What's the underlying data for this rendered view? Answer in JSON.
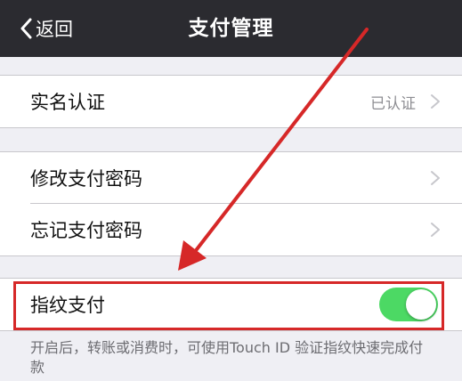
{
  "navbar": {
    "back_label": "返回",
    "title": "支付管理"
  },
  "sections": {
    "realname": {
      "label": "实名认证",
      "value": "已认证"
    },
    "change_password": {
      "label": "修改支付密码"
    },
    "forgot_password": {
      "label": "忘记支付密码"
    },
    "fingerprint": {
      "label": "指纹支付",
      "enabled": true
    }
  },
  "footnote": "开启后，转账或消费时，可使用Touch ID 验证指纹快速完成付款",
  "colors": {
    "navbar_bg": "#2b2b30",
    "toggle_on": "#4cd964",
    "annotation_red": "#d62828",
    "page_bg": "#efeff4"
  }
}
